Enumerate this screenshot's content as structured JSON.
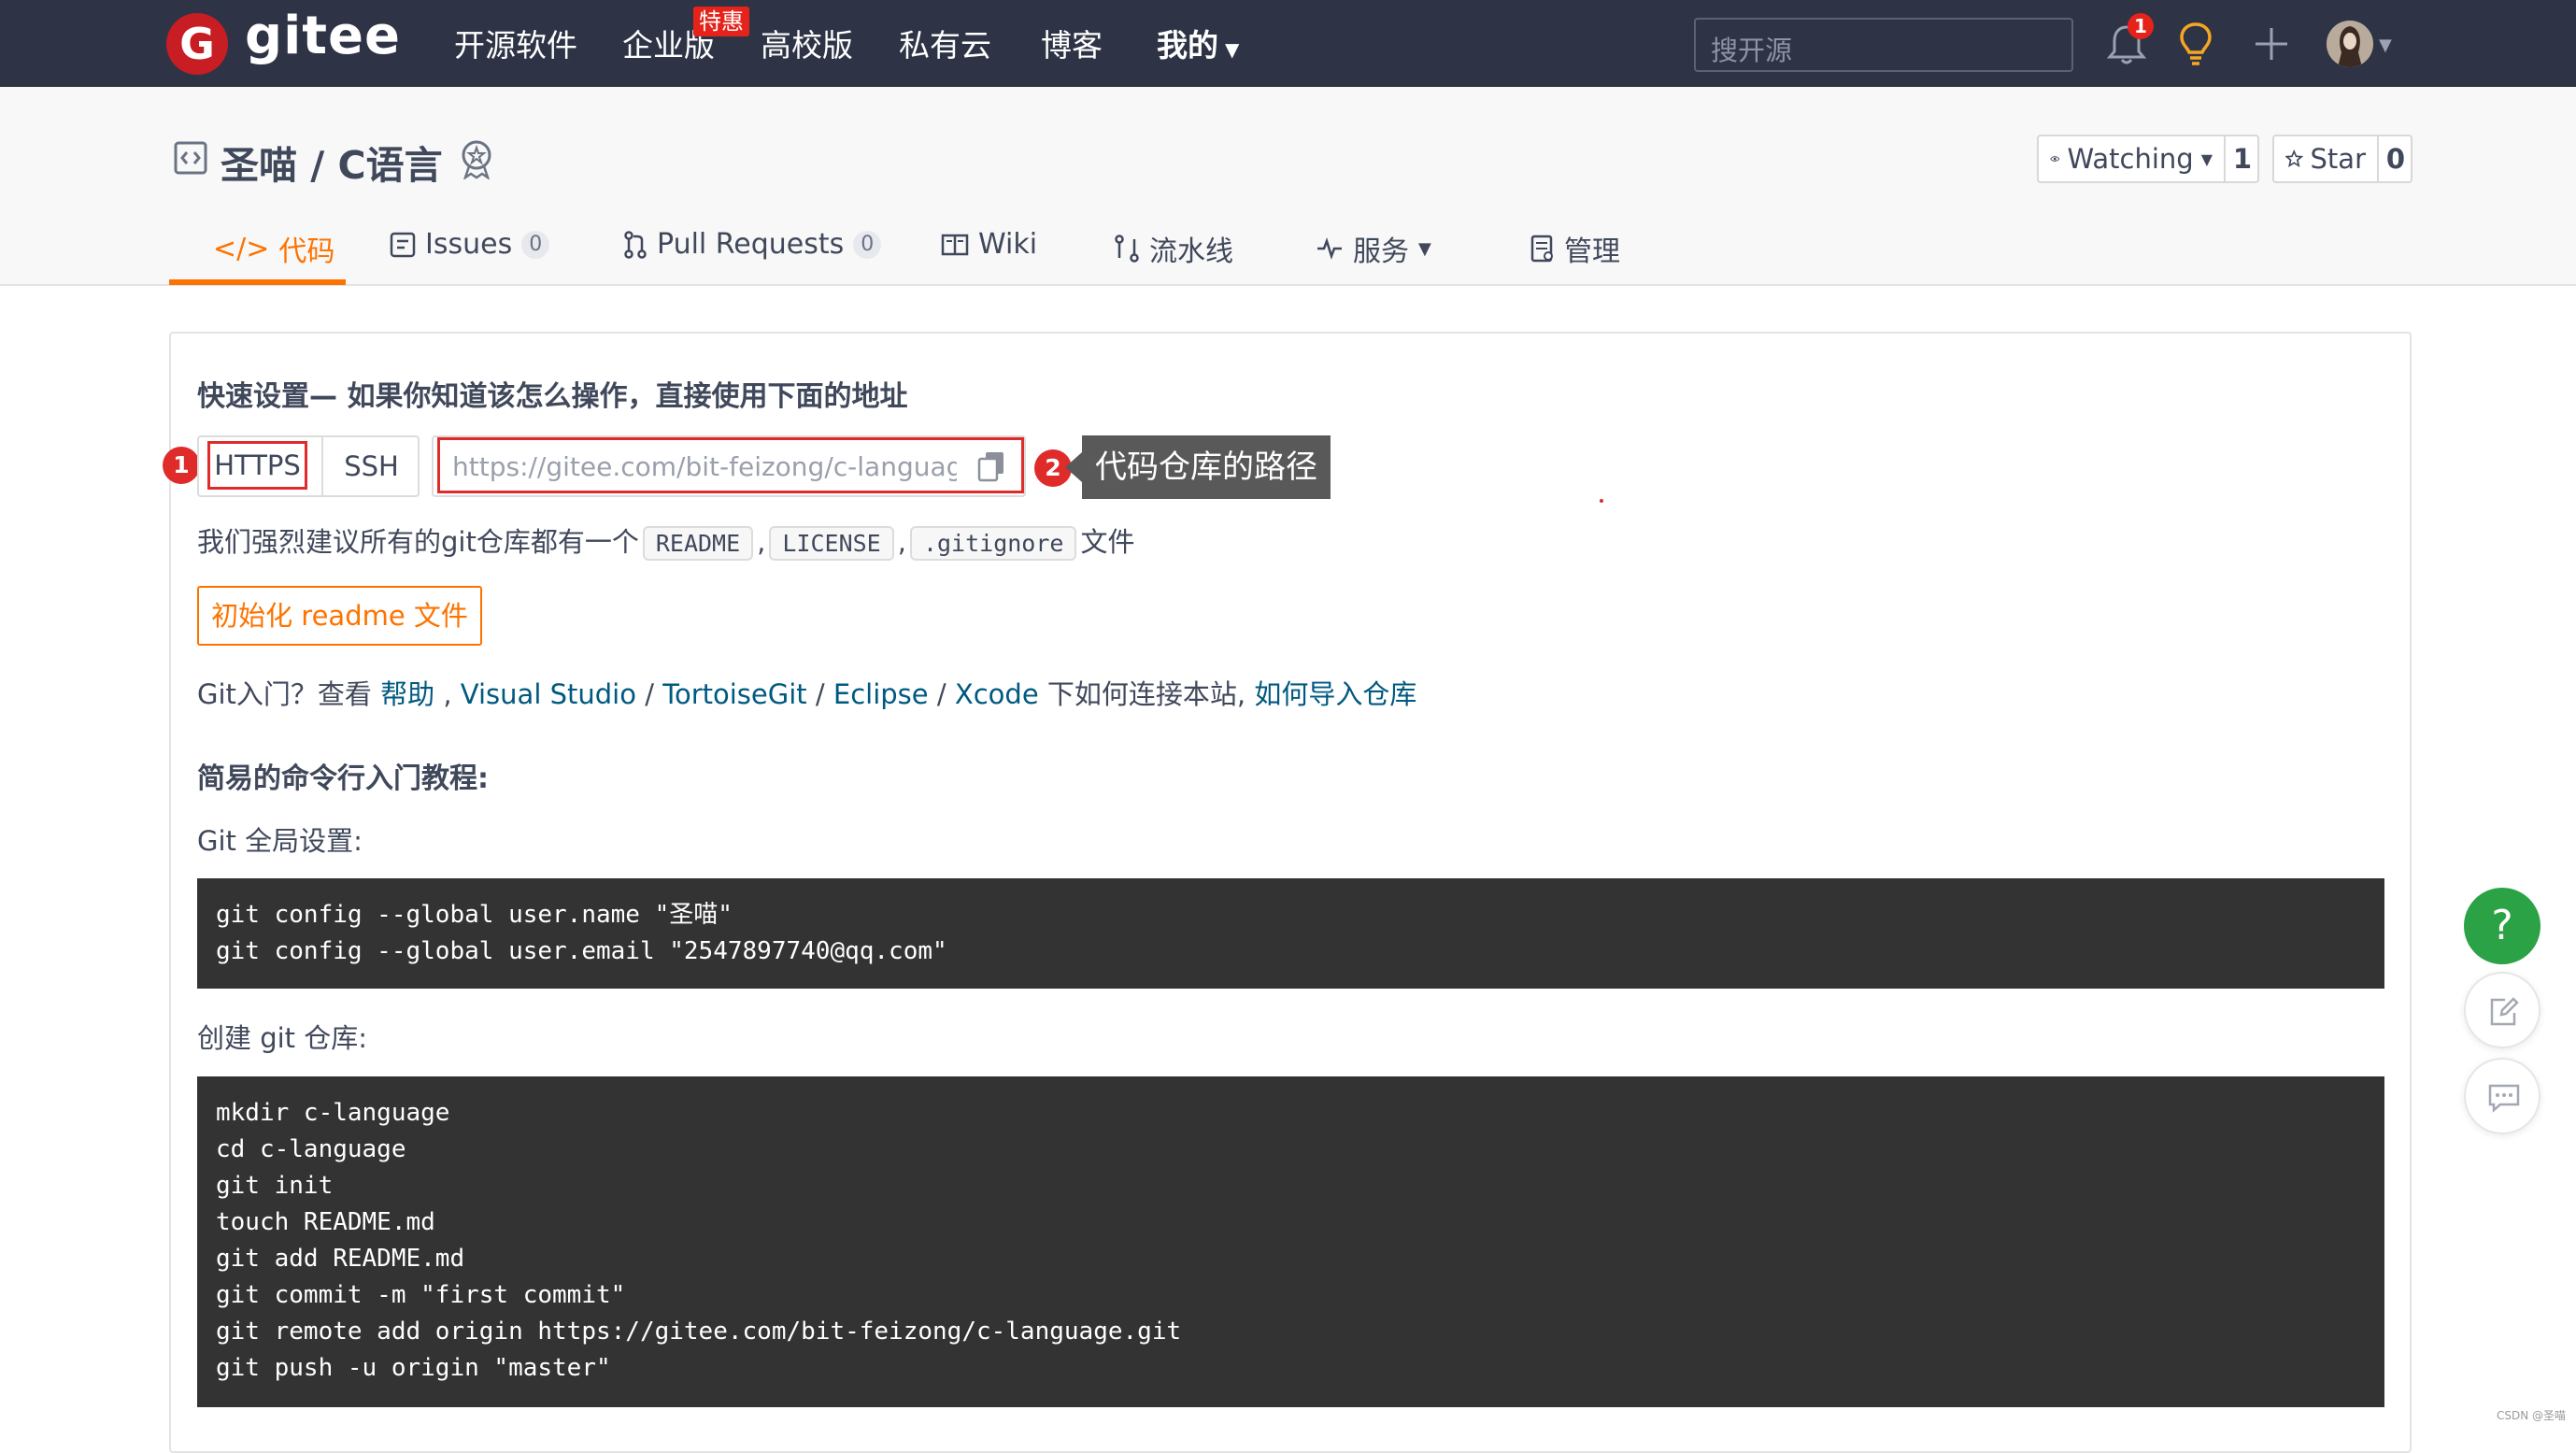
{
  "nav": {
    "logo_letter": "G",
    "logo_text": "gitee",
    "items": [
      "开源软件",
      "企业版",
      "高校版",
      "私有云",
      "博客",
      "我的"
    ],
    "enterprise_badge": "特惠",
    "search_placeholder": "搜开源",
    "notification_count": "1"
  },
  "repo": {
    "title": "圣喵 / C语言",
    "watching_label": "Watching",
    "watching_count": "1",
    "star_label": "Star",
    "star_count": "0"
  },
  "tabs": [
    {
      "label": "代码",
      "active": true
    },
    {
      "label": "Issues",
      "count": "0"
    },
    {
      "label": "Pull Requests",
      "count": "0"
    },
    {
      "label": "Wiki"
    },
    {
      "label": "流水线"
    },
    {
      "label": "服务"
    },
    {
      "label": "管理"
    }
  ],
  "setup": {
    "heading": "快速设置— 如果你知道该怎么操作，直接使用下面的地址",
    "protocols": [
      "HTTPS",
      "SSH"
    ],
    "url": "https://gitee.com/bit-feizong/c-language.git",
    "annotation_1": "1",
    "annotation_2": "2",
    "tooltip": "代码仓库的路径",
    "recommend_prefix": "我们强烈建议所有的git仓库都有一个",
    "files": [
      "README",
      "LICENSE",
      ".gitignore"
    ],
    "recommend_suffix": "文件",
    "init_button": "初始化 readme 文件",
    "help_prefix": "Git入门？查看",
    "help_link": "帮助",
    "tools": [
      "Visual Studio",
      "TortoiseGit",
      "Eclipse",
      "Xcode"
    ],
    "help_mid": "下如何连接本站,",
    "import_link": "如何导入仓库"
  },
  "tutorial": {
    "heading": "简易的命令行入门教程:",
    "global_label": "Git 全局设置:",
    "global_code": "git config --global user.name \"圣喵\"\ngit config --global user.email \"2547897740@qq.com\"",
    "create_label": "创建 git 仓库:",
    "create_code": "mkdir c-language\ncd c-language\ngit init\ntouch README.md\ngit add README.md\ngit commit -m \"first commit\"\ngit remote add origin https://gitee.com/bit-feizong/c-language.git\ngit push -u origin \"master\""
  },
  "side": {
    "help": "?"
  },
  "watermark": "CSDN @圣喵",
  "colors": {
    "nav_bg": "#2e3446",
    "accent": "#fe7300",
    "brand": "#c71d23",
    "help_green": "#2ba245",
    "annotation_red": "#e02b2b"
  }
}
